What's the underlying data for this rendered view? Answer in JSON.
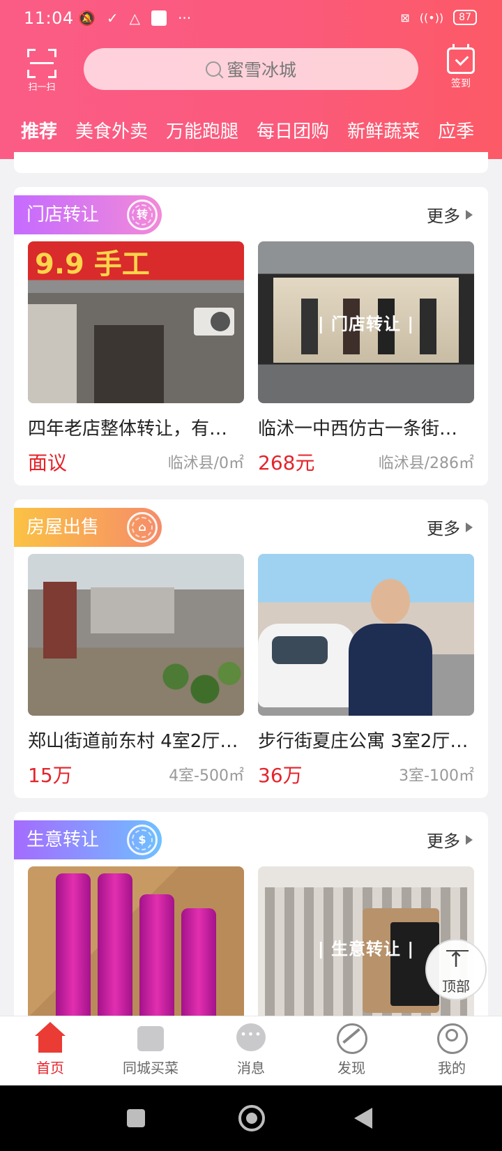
{
  "status_bar": {
    "time": "11:04",
    "battery": "87"
  },
  "header": {
    "scan_label": "扫一扫",
    "search_placeholder": "蜜雪冰城",
    "signin_label": "签到",
    "tabs": [
      "推荐",
      "美食外卖",
      "万能跑腿",
      "每日团购",
      "新鲜蔬菜",
      "应季"
    ]
  },
  "sections": [
    {
      "title": "门店转让",
      "icon_char": "转",
      "more": "更多",
      "color": "#c86dff",
      "items": [
        {
          "title": "四年老店整体转让，有…",
          "price": "面议",
          "meta": "临沭县/0㎡",
          "overlay": ""
        },
        {
          "title": "临沭一中西仿古一条街…",
          "price": "268元",
          "meta": "临沭县/286㎡",
          "overlay": "| 门店转让 |"
        }
      ]
    },
    {
      "title": "房屋出售",
      "icon_char": "⌂",
      "more": "更多",
      "color": "#fbb347",
      "items": [
        {
          "title": "郑山街道前东村 4室2厅…",
          "price": "15万",
          "meta": "4室-500㎡",
          "overlay": ""
        },
        {
          "title": "步行街夏庄公寓 3室2厅…",
          "price": "36万",
          "meta": "3室-100㎡",
          "overlay": ""
        }
      ]
    },
    {
      "title": "生意转让",
      "icon_char": "$",
      "more": "更多",
      "color": "#a36cff",
      "items": [
        {
          "title": "",
          "price": "",
          "meta": "",
          "overlay": ""
        },
        {
          "title": "",
          "price": "",
          "meta": "",
          "overlay": "| 生意转让 |"
        }
      ]
    }
  ],
  "floating": {
    "top_label": "顶部"
  },
  "bottom_nav": [
    "首页",
    "同城买菜",
    "消息",
    "发现",
    "我的"
  ],
  "colors": {
    "brand_pink": "#fb5c86",
    "price_red": "#e5232b"
  }
}
